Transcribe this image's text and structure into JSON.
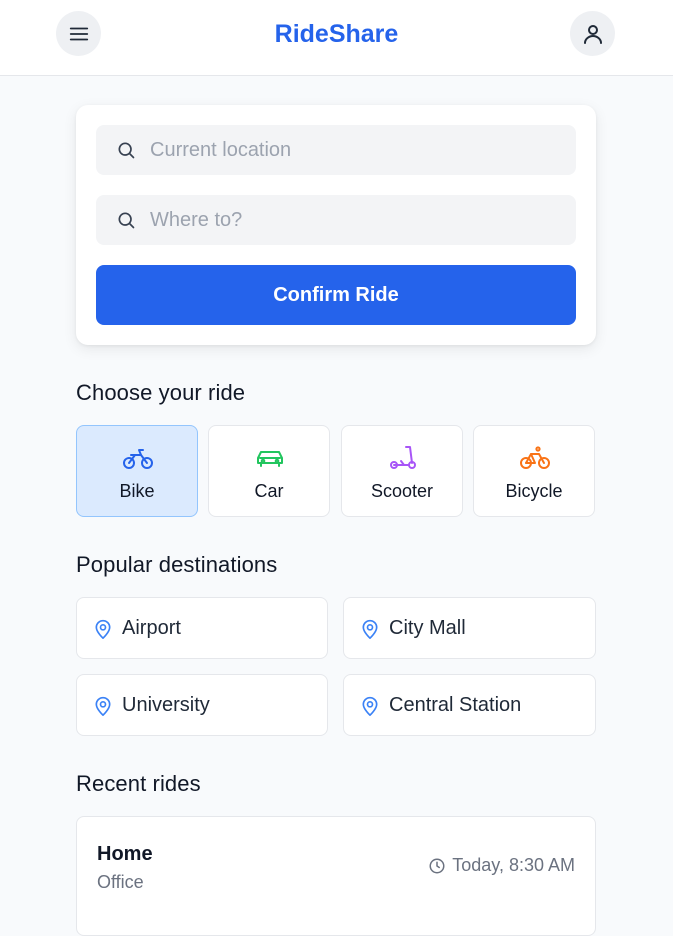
{
  "header": {
    "brand": "RideShare",
    "menu_icon": "menu-icon",
    "profile_icon": "user-icon"
  },
  "booking": {
    "pickup": {
      "placeholder": "Current location",
      "value": "",
      "icon": "search-icon"
    },
    "dropoff": {
      "placeholder": "Where to?",
      "value": "",
      "icon": "search-icon"
    },
    "confirm_label": "Confirm Ride"
  },
  "rides": {
    "title": "Choose your ride",
    "selected": "Bike",
    "options": [
      {
        "label": "Bike",
        "icon": "motorbike-icon",
        "color": "#2563eb"
      },
      {
        "label": "Car",
        "icon": "car-icon",
        "color": "#22c55e"
      },
      {
        "label": "Scooter",
        "icon": "scooter-icon",
        "color": "#a855f7"
      },
      {
        "label": "Bicycle",
        "icon": "bicycle-icon",
        "color": "#f97316"
      }
    ]
  },
  "destinations": {
    "title": "Popular destinations",
    "items": [
      {
        "label": "Airport",
        "icon": "map-pin-icon"
      },
      {
        "label": "City Mall",
        "icon": "map-pin-icon"
      },
      {
        "label": "University",
        "icon": "map-pin-icon"
      },
      {
        "label": "Central Station",
        "icon": "map-pin-icon"
      }
    ]
  },
  "recent": {
    "title": "Recent rides",
    "items": [
      {
        "from": "Home",
        "to": "Office",
        "time": "Today, 8:30 AM",
        "icon": "clock-icon"
      }
    ]
  },
  "colors": {
    "accent": "#2563eb",
    "selected_bg": "#dbeafe",
    "pin": "#3b82f6"
  }
}
